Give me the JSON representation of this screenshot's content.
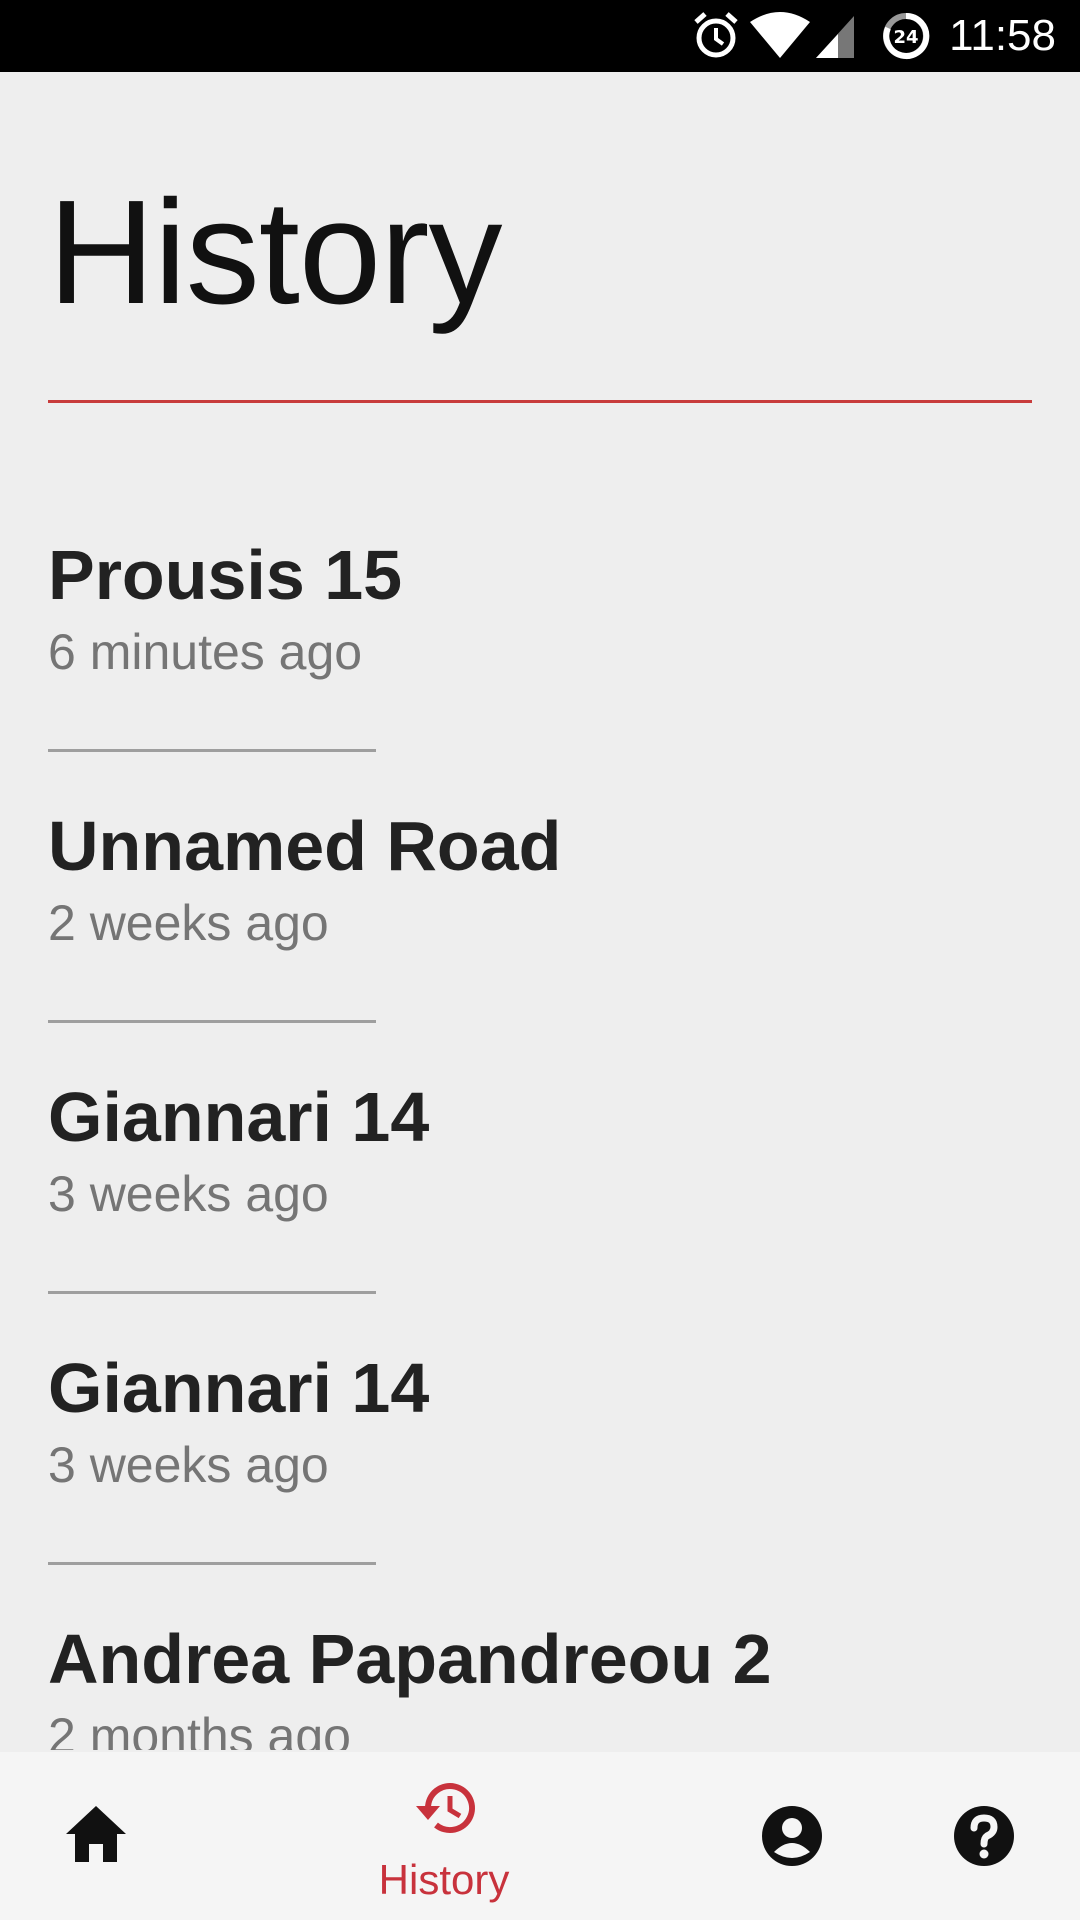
{
  "status_bar": {
    "time": "11:58",
    "icons": [
      "alarm-icon",
      "wifi-icon",
      "signal-icon",
      "data-saver-24-icon"
    ],
    "data_saver_badge": "24"
  },
  "header": {
    "title": "History",
    "accent_color": "#c83c3c"
  },
  "history": {
    "items": [
      {
        "title": "Prousis 15",
        "time": "6 minutes ago"
      },
      {
        "title": "Unnamed Road",
        "time": "2 weeks ago"
      },
      {
        "title": "Giannari 14",
        "time": "3 weeks ago"
      },
      {
        "title": "Giannari 14",
        "time": "3 weeks ago"
      },
      {
        "title": "Andrea Papandreou 2",
        "time": "2 months ago"
      }
    ]
  },
  "bottom_nav": {
    "active_color": "#c8323c",
    "items": [
      {
        "icon": "home-icon"
      },
      {
        "icon": "history-icon",
        "label": "History",
        "active": true
      },
      {
        "icon": "account-icon"
      },
      {
        "icon": "help-icon"
      }
    ]
  }
}
